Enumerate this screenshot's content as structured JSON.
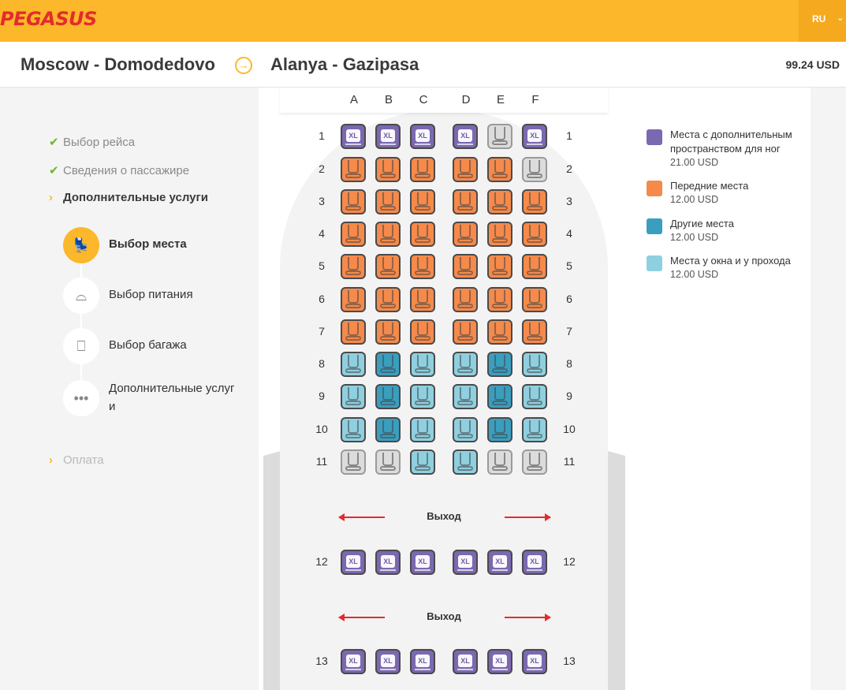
{
  "header": {
    "logo": "PEGASUS",
    "language": "RU",
    "chevron_icon": "chevron-down-icon"
  },
  "route": {
    "from": "Moscow - Domodedovo",
    "to": "Alanya - Gazipasa",
    "arrow_icon": "arrow-right-circle-icon",
    "total_price": "99.24 USD"
  },
  "steps": [
    {
      "label": "Выбор рейса",
      "state": "done"
    },
    {
      "label": "Сведения о пассажире",
      "state": "done"
    },
    {
      "label": "Дополнительные услуги",
      "state": "active"
    },
    {
      "label": "Оплата",
      "state": "pending"
    }
  ],
  "substeps": [
    {
      "label": "Выбор места",
      "icon": "seat-icon",
      "glyph": "💺",
      "active": true
    },
    {
      "label": "Выбор питания",
      "icon": "food-cloche-icon",
      "glyph": "⌓",
      "active": false
    },
    {
      "label": "Выбор багажа",
      "icon": "luggage-icon",
      "glyph": "🧳",
      "active": false
    },
    {
      "label": "Дополнительные услуг",
      "label2": "и",
      "icon": "more-dots-icon",
      "glyph": "•••",
      "active": false
    }
  ],
  "seatmap": {
    "columns": [
      "A",
      "B",
      "C",
      "D",
      "E",
      "F"
    ],
    "exit_label": "Выход",
    "rows": [
      {
        "num": "1",
        "seats": [
          "xl",
          "xl",
          "xl",
          "xl",
          "na",
          "xl"
        ]
      },
      {
        "num": "2",
        "seats": [
          "front",
          "front",
          "front",
          "front",
          "front",
          "na"
        ]
      },
      {
        "num": "3",
        "seats": [
          "front",
          "front",
          "front",
          "front",
          "front",
          "front"
        ]
      },
      {
        "num": "4",
        "seats": [
          "front",
          "front",
          "front",
          "front",
          "front",
          "front"
        ]
      },
      {
        "num": "5",
        "seats": [
          "front",
          "front",
          "front",
          "front",
          "front",
          "front"
        ]
      },
      {
        "num": "6",
        "seats": [
          "front",
          "front",
          "front",
          "front",
          "front",
          "front"
        ]
      },
      {
        "num": "7",
        "seats": [
          "front",
          "front",
          "front",
          "front",
          "front",
          "front"
        ]
      },
      {
        "num": "8",
        "seats": [
          "window",
          "other",
          "window",
          "window",
          "other",
          "window"
        ]
      },
      {
        "num": "9",
        "seats": [
          "window",
          "other",
          "window",
          "window",
          "other",
          "window"
        ]
      },
      {
        "num": "10",
        "seats": [
          "window",
          "other",
          "window",
          "window",
          "other",
          "window"
        ]
      },
      {
        "num": "11",
        "seats": [
          "na",
          "na",
          "window",
          "window",
          "na",
          "na"
        ]
      },
      {
        "num": "12",
        "seats": [
          "xl",
          "xl",
          "xl",
          "xl",
          "xl",
          "xl"
        ]
      },
      {
        "num": "13",
        "seats": [
          "xl",
          "xl",
          "xl",
          "xl",
          "xl",
          "xl"
        ]
      }
    ],
    "seat_colors": {
      "xl": "#7b68b0",
      "front": "#f58a4b",
      "other": "#3a9ebf",
      "window": "#8fd0e0",
      "na": "#dcdcdc"
    },
    "xl_badge": "XL"
  },
  "legend": [
    {
      "name": "Места с дополнительным пространством для ног",
      "price": "21.00 USD",
      "color": "#7b68b0"
    },
    {
      "name": "Передние места",
      "price": "12.00 USD",
      "color": "#f58a4b"
    },
    {
      "name": "Другие места",
      "price": "12.00 USD",
      "color": "#3a9ebf"
    },
    {
      "name": "Места у окна и у прохода",
      "price": "12.00 USD",
      "color": "#8fd0e0"
    }
  ]
}
